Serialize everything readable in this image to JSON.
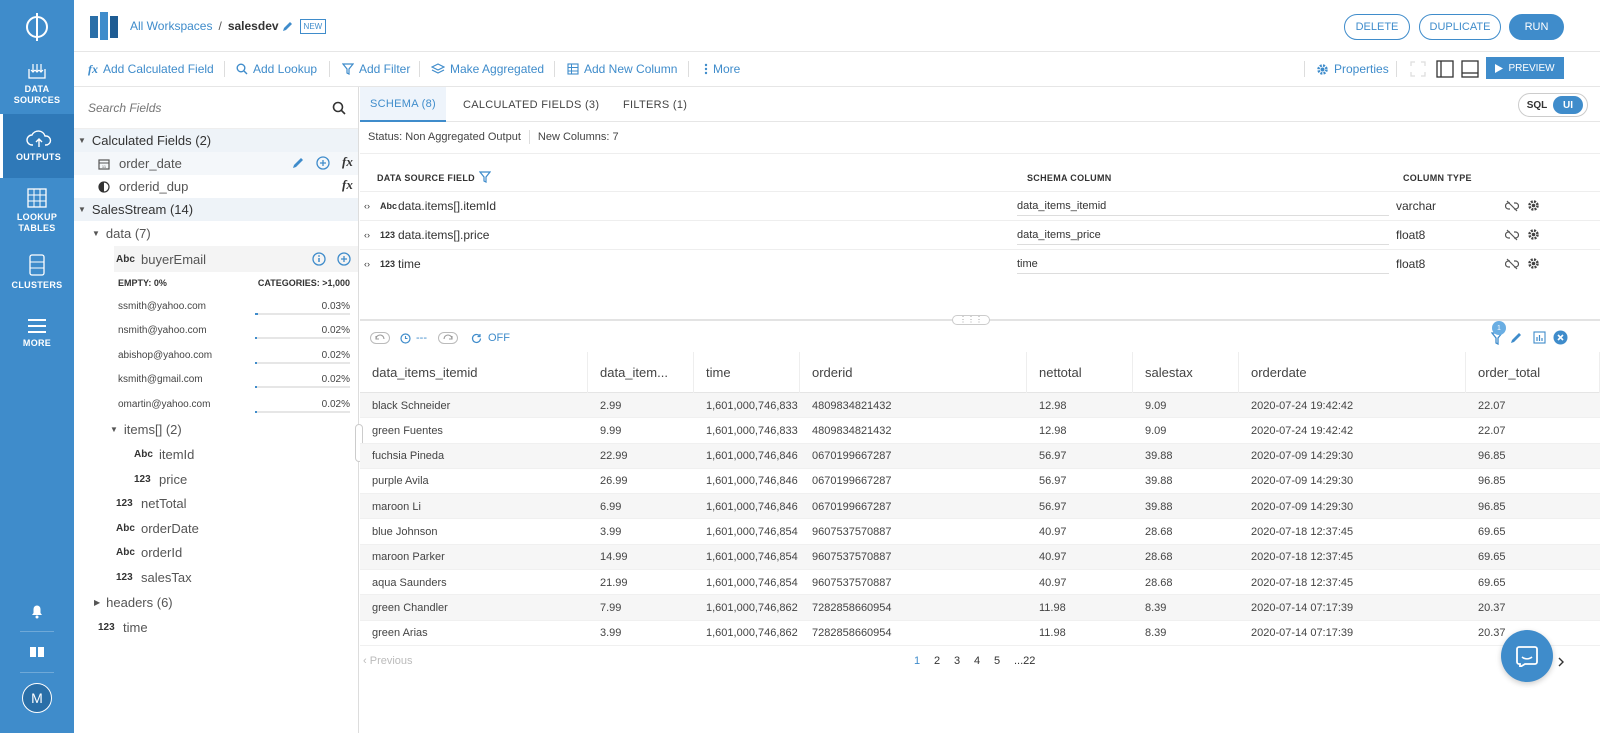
{
  "nav": {
    "items": [
      {
        "label1": "DATA",
        "label2": "SOURCES"
      },
      {
        "label1": "OUTPUTS",
        "label2": ""
      },
      {
        "label1": "LOOKUP",
        "label2": "TABLES"
      },
      {
        "label1": "CLUSTERS",
        "label2": ""
      },
      {
        "label1": "MORE",
        "label2": ""
      }
    ],
    "avatar": "M"
  },
  "header": {
    "workspaces_link": "All Workspaces",
    "separator": "/",
    "name": "salesdev",
    "badge": "NEW",
    "delete_label": "DELETE",
    "duplicate_label": "DUPLICATE",
    "run_label": "RUN"
  },
  "toolbar": {
    "fx": "fx",
    "add_calculated_field": "Add Calculated Field",
    "add_lookup": "Add Lookup",
    "add_filter": "Add Filter",
    "make_aggregated": "Make Aggregated",
    "add_new_column": "Add New Column",
    "more": "More",
    "properties": "Properties",
    "preview": "PREVIEW"
  },
  "fields": {
    "search_placeholder": "Search Fields",
    "calc_group": "Calculated Fields (2)",
    "calc_fields": [
      "order_date",
      "orderid_dup"
    ],
    "stream_group": "SalesStream (14)",
    "data_group": "data (7)",
    "buyer_type": "Abc",
    "buyer_email": "buyerEmail",
    "empty_label": "EMPTY: 0%",
    "categories_label": "CATEGORIES: >1,000",
    "values": [
      {
        "email": "ssmith@yahoo.com",
        "pct": "0.03%",
        "fill": 0.03
      },
      {
        "email": "nsmith@yahoo.com",
        "pct": "0.02%",
        "fill": 0.02
      },
      {
        "email": "abishop@yahoo.com",
        "pct": "0.02%",
        "fill": 0.02
      },
      {
        "email": "ksmith@gmail.com",
        "pct": "0.02%",
        "fill": 0.02
      },
      {
        "email": "omartin@yahoo.com",
        "pct": "0.02%",
        "fill": 0.02
      }
    ],
    "items_group": "items[] (2)",
    "item_fields": [
      {
        "type": "Abc",
        "name": "itemId"
      },
      {
        "type": "123",
        "name": "price"
      }
    ],
    "data_fields": [
      {
        "type": "123",
        "name": "netTotal"
      },
      {
        "type": "Abc",
        "name": "orderDate"
      },
      {
        "type": "Abc",
        "name": "orderId"
      },
      {
        "type": "123",
        "name": "salesTax"
      }
    ],
    "headers_group": "headers (6)",
    "time_type": "123",
    "time_name": "time"
  },
  "tabs": [
    "SCHEMA (8)",
    "CALCULATED FIELDS (3)",
    "FILTERS (1)"
  ],
  "toggle": {
    "sql": "SQL",
    "ui": "UI"
  },
  "status": {
    "text": "Status:  Non Aggregated Output",
    "newcols": "New Columns: 7"
  },
  "schema": {
    "headers": [
      "DATA SOURCE FIELD",
      "SCHEMA COLUMN",
      "COLUMN TYPE"
    ],
    "rows": [
      {
        "type": "Abc",
        "field": "data.items[].itemId",
        "column": "data_items_itemid",
        "ctype": "varchar"
      },
      {
        "type": "123",
        "field": "data.items[].price",
        "column": "data_items_price",
        "ctype": "float8"
      },
      {
        "type": "123",
        "field": "time",
        "column": "time",
        "ctype": "float8"
      }
    ]
  },
  "preview_controls": {
    "dash": "---",
    "off": "OFF",
    "filter_count": "1"
  },
  "grid": {
    "columns": [
      "data_items_itemid",
      "data_item...",
      "time",
      "orderid",
      "nettotal",
      "salestax",
      "orderdate",
      "order_total"
    ],
    "rows": [
      [
        "black Schneider",
        "2.99",
        "1,601,000,746,833",
        "4809834821432",
        "12.98",
        "9.09",
        "2020-07-24 19:42:42",
        "22.07"
      ],
      [
        "green Fuentes",
        "9.99",
        "1,601,000,746,833",
        "4809834821432",
        "12.98",
        "9.09",
        "2020-07-24 19:42:42",
        "22.07"
      ],
      [
        "fuchsia Pineda",
        "22.99",
        "1,601,000,746,846",
        "0670199667287",
        "56.97",
        "39.88",
        "2020-07-09 14:29:30",
        "96.85"
      ],
      [
        "purple Avila",
        "26.99",
        "1,601,000,746,846",
        "0670199667287",
        "56.97",
        "39.88",
        "2020-07-09 14:29:30",
        "96.85"
      ],
      [
        "maroon Li",
        "6.99",
        "1,601,000,746,846",
        "0670199667287",
        "56.97",
        "39.88",
        "2020-07-09 14:29:30",
        "96.85"
      ],
      [
        "blue Johnson",
        "3.99",
        "1,601,000,746,854",
        "9607537570887",
        "40.97",
        "28.68",
        "2020-07-18 12:37:45",
        "69.65"
      ],
      [
        "maroon Parker",
        "14.99",
        "1,601,000,746,854",
        "9607537570887",
        "40.97",
        "28.68",
        "2020-07-18 12:37:45",
        "69.65"
      ],
      [
        "aqua Saunders",
        "21.99",
        "1,601,000,746,854",
        "9607537570887",
        "40.97",
        "28.68",
        "2020-07-18 12:37:45",
        "69.65"
      ],
      [
        "green Chandler",
        "7.99",
        "1,601,000,746,862",
        "7282858660954",
        "11.98",
        "8.39",
        "2020-07-14 07:17:39",
        "20.37"
      ],
      [
        "green Arias",
        "3.99",
        "1,601,000,746,862",
        "7282858660954",
        "11.98",
        "8.39",
        "2020-07-14 07:17:39",
        "20.37"
      ]
    ]
  },
  "pager": {
    "previous": "Previous",
    "pages": [
      "1",
      "2",
      "3",
      "4",
      "5",
      "...22"
    ],
    "current": "1"
  },
  "colors": {
    "accent": "#3f8ccb",
    "nav_bg": "#3f8ccb",
    "nav_active": "#2f79b8"
  }
}
